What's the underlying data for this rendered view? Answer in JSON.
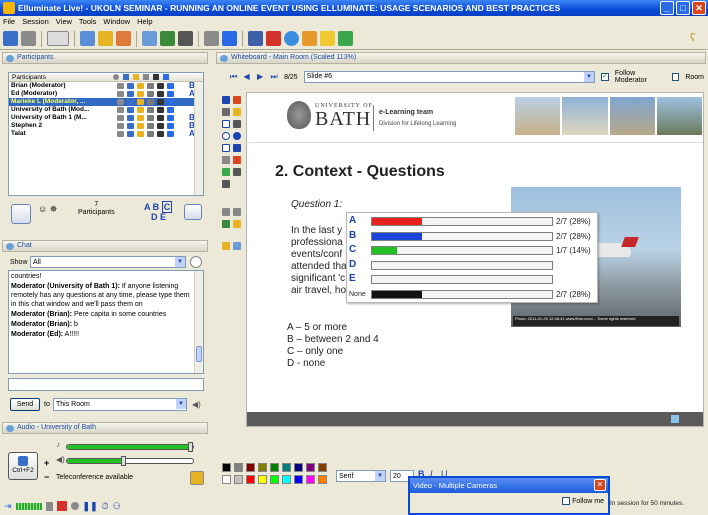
{
  "window": {
    "title": "Elluminate Live! - UKOLN SEMINAR - RUNNING AN ONLINE EVENT USING ELLUMINATE: USAGE SCENARIOS AND BEST PRACTICES",
    "min": "_",
    "max": "□",
    "close": "✕"
  },
  "menu": [
    "File",
    "Session",
    "View",
    "Tools",
    "Window",
    "Help"
  ],
  "participants": {
    "panel_title": "Participants",
    "header": "Participants",
    "rows": [
      {
        "name": "Brian (Moderator)",
        "badge": "B",
        "selected": false
      },
      {
        "name": "Ed (Moderator)",
        "badge": "A",
        "selected": false
      },
      {
        "name": "Marieke L (Moderator, ...",
        "badge": "",
        "selected": true
      },
      {
        "name": "University of Bath (Mod...",
        "badge": "",
        "selected": false
      },
      {
        "name": "University of Bath 1 (M...",
        "badge": "B",
        "selected": false
      },
      {
        "name": "Stephen 2",
        "badge": "B",
        "selected": false
      },
      {
        "name": "Talat",
        "badge": "A",
        "selected": false
      }
    ],
    "count": "7",
    "count_label": "Participants",
    "abcde": [
      "A B",
      "C",
      "D E"
    ]
  },
  "chat": {
    "panel_title": "Chat",
    "show_label": "Show",
    "show_value": "All",
    "messages": [
      {
        "from": "",
        "text": "countries!"
      },
      {
        "from": "Moderator (University of Bath 1):",
        "text": " If anyone listening remotely has any questions at any time, please type them in this chat window and we'll pass them on"
      },
      {
        "from": "Moderator (Brian):",
        "text": " Pere capita in some countries"
      },
      {
        "from": "Moderator (Brian):",
        "text": " b"
      },
      {
        "from": "Moderator (Ed):",
        "text": " A!!!!!"
      }
    ],
    "send_label": "Send",
    "to_label": "to",
    "to_value": "This Room"
  },
  "audio": {
    "panel_title": "Audio - University of Bath",
    "talk_key": "Ctrl+F2",
    "plus": "+",
    "minus": "−",
    "teleconference": "Teleconference available",
    "mic_level": 1.0,
    "speaker_level": 0.45
  },
  "whiteboard": {
    "panel_title": "Whiteboard - Main Room (Scaled 113%)",
    "page": "8/25",
    "slide": "Slide #6",
    "follow_moderator": "Follow Moderator",
    "room": "Room",
    "slide_content": {
      "uni_small": "UNIVERSITY OF",
      "uni_big": "BATH",
      "team": "e-Learning team",
      "division": "Division for Lifelong Learning",
      "title": "2. Context - Questions",
      "question": "Question 1:",
      "question_text": [
        "In the last y",
        "professiona",
        "events/conf",
        "attended tha",
        "significant 'c",
        "air travel, ho"
      ],
      "answers": [
        "A – 5 or more",
        "B – between 2 and 4",
        "C – only one",
        "D - none"
      ],
      "photo_credit": "Photo: 2011-01-29 12:46:41 www.flickr.com/... Some rights reserved"
    },
    "poll": [
      {
        "label": "A",
        "fraction": 0.28,
        "value": "2/7 (28%)",
        "color": "#e8201e"
      },
      {
        "label": "B",
        "fraction": 0.28,
        "value": "2/7 (28%)",
        "color": "#1b44d8"
      },
      {
        "label": "C",
        "fraction": 0.14,
        "value": "1/7 (14%)",
        "color": "#22c022"
      },
      {
        "label": "D",
        "fraction": 0,
        "value": "",
        "color": "#888888"
      },
      {
        "label": "E",
        "fraction": 0,
        "value": "",
        "color": "#888888"
      },
      {
        "label": "None",
        "fraction": 0.28,
        "value": "2/7 (28%)",
        "color": "#111111"
      }
    ]
  },
  "format": {
    "font": "Serif",
    "size": "20",
    "bold": "B",
    "italic": "I",
    "underline": "U"
  },
  "video": {
    "title": "Video - Multiple Cameras",
    "follow_me": "Follow me"
  },
  "status": "In session for 50 minutes."
}
